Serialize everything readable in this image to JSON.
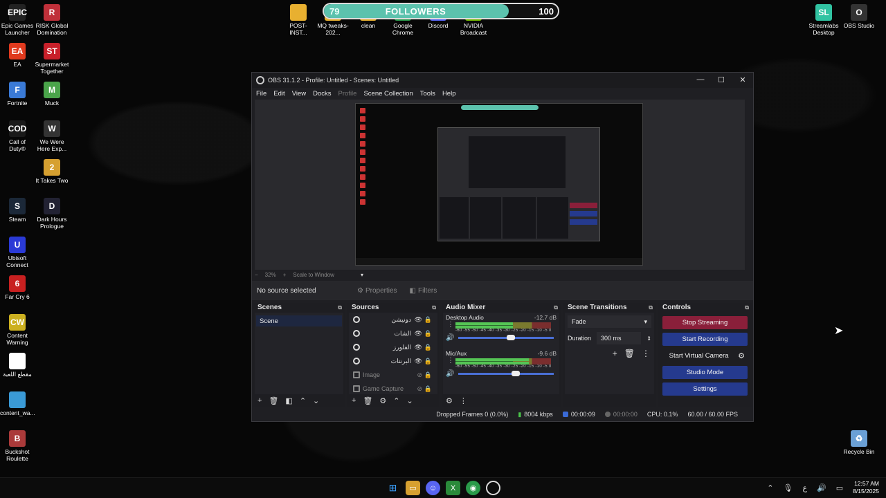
{
  "desktop_icons_left": [
    {
      "label": "Epic Games Launcher",
      "glyph": "EPIC",
      "color": "#222222"
    },
    {
      "label": "RISK Global Domination",
      "glyph": "R",
      "color": "#c0303a"
    },
    {
      "label": "EA",
      "glyph": "EA",
      "color": "#e03a1e"
    },
    {
      "label": "Supermarket Together",
      "glyph": "ST",
      "color": "#c8202a"
    },
    {
      "label": "Fortnite",
      "glyph": "F",
      "color": "#3a7ad6"
    },
    {
      "label": "Muck",
      "glyph": "M",
      "color": "#4aa44a"
    },
    {
      "label": "Call of Duty®",
      "glyph": "COD",
      "color": "#1a1a1a"
    },
    {
      "label": "We Were Here Exp...",
      "glyph": "W",
      "color": "#333333"
    },
    {
      "label": "It Takes Two",
      "glyph": "2",
      "color": "#d6a030"
    },
    {
      "label": "Steam",
      "glyph": "S",
      "color": "#1b2838"
    },
    {
      "label": "Dark Hours Prologue",
      "glyph": "D",
      "color": "#222233"
    },
    {
      "label": "Ubisoft Connect",
      "glyph": "U",
      "color": "#2a3ad6"
    },
    {
      "label": "Far Cry 6",
      "glyph": "6",
      "color": "#c82020"
    },
    {
      "label": "Content Warning",
      "glyph": "CW",
      "color": "#ccb020"
    },
    {
      "label": "مقطع اللعبة",
      "glyph": "",
      "color": "#ffffff"
    },
    {
      "label": "content_wa...",
      "glyph": "",
      "color": "#3a9ad6"
    },
    {
      "label": "Buckshot Roulette",
      "glyph": "B",
      "color": "#aa3a3a"
    }
  ],
  "desktop_icons_top": [
    {
      "label": "POST-INST...",
      "glyph": "",
      "color": "#e8b030"
    },
    {
      "label": "MQ tweaks-202...",
      "glyph": "",
      "color": "#e8b030"
    },
    {
      "label": "clean",
      "glyph": "",
      "color": "#e8b030"
    },
    {
      "label": "Google Chrome",
      "glyph": "",
      "color": "#2a9a4a"
    },
    {
      "label": "Discord",
      "glyph": "",
      "color": "#5865f2"
    },
    {
      "label": "NVIDIA Broadcast",
      "glyph": "",
      "color": "#76b900"
    }
  ],
  "desktop_icons_right": [
    {
      "label": "Streamlabs Desktop",
      "glyph": "SL",
      "color": "#31c3a2"
    },
    {
      "label": "OBS Studio",
      "glyph": "O",
      "color": "#333333"
    },
    {
      "label": "Recycle Bin",
      "glyph": "♻",
      "color": "#6aa0d6"
    }
  ],
  "followers": {
    "current": "79",
    "label": "FOLLOWERS",
    "goal": "100",
    "progress": 0.79,
    "color": "#5cc2ad"
  },
  "obs": {
    "title": "OBS 31.1.2 - Profile: Untitled - Scenes: Untitled",
    "menu": [
      "File",
      "Edit",
      "View",
      "Docks",
      "Profile",
      "Scene Collection",
      "Tools",
      "Help"
    ],
    "zoom": "32%",
    "scale_mode": "Scale to Window",
    "no_source": "No source selected",
    "properties_label": "Properties",
    "filters_label": "Filters",
    "scenes": {
      "title": "Scenes",
      "items": [
        "Scene"
      ]
    },
    "sources": {
      "title": "Sources",
      "items": [
        {
          "name": "دونيشن",
          "dim": false
        },
        {
          "name": "الشات",
          "dim": false
        },
        {
          "name": "الفلورز",
          "dim": false
        },
        {
          "name": "البرنتات",
          "dim": false
        },
        {
          "name": "Image",
          "dim": true
        },
        {
          "name": "Game Capture",
          "dim": true
        }
      ]
    },
    "mixer": {
      "title": "Audio Mixer",
      "channels": [
        {
          "name": "Desktop Audio",
          "db": "-12.7 dB",
          "level": 0.6,
          "volume": 0.55
        },
        {
          "name": "Mic/Aux",
          "db": "-9.6 dB",
          "level": 0.77,
          "volume": 0.6
        }
      ],
      "scale": "-60 -55 -50 -45 -40 -35 -30 -25 -20 -15 -10 -5 0"
    },
    "transitions": {
      "title": "Scene Transitions",
      "selected": "Fade",
      "duration_label": "Duration",
      "duration": "300 ms"
    },
    "controls": {
      "title": "Controls",
      "stop_streaming": "Stop Streaming",
      "start_recording": "Start Recording",
      "start_virtual_camera": "Start Virtual Camera",
      "studio_mode": "Studio Mode",
      "settings": "Settings"
    },
    "status": {
      "dropped": "Dropped Frames 0 (0.0%)",
      "bitrate": "8004 kbps",
      "stream_time": "00:00:09",
      "rec_time": "00:00:00",
      "cpu": "CPU: 0.1%",
      "fps": "60.00 / 60.00 FPS"
    }
  },
  "taskbar": {
    "clock_time": "12:57 AM",
    "clock_date": "8/15/2025",
    "lang": "ع"
  }
}
